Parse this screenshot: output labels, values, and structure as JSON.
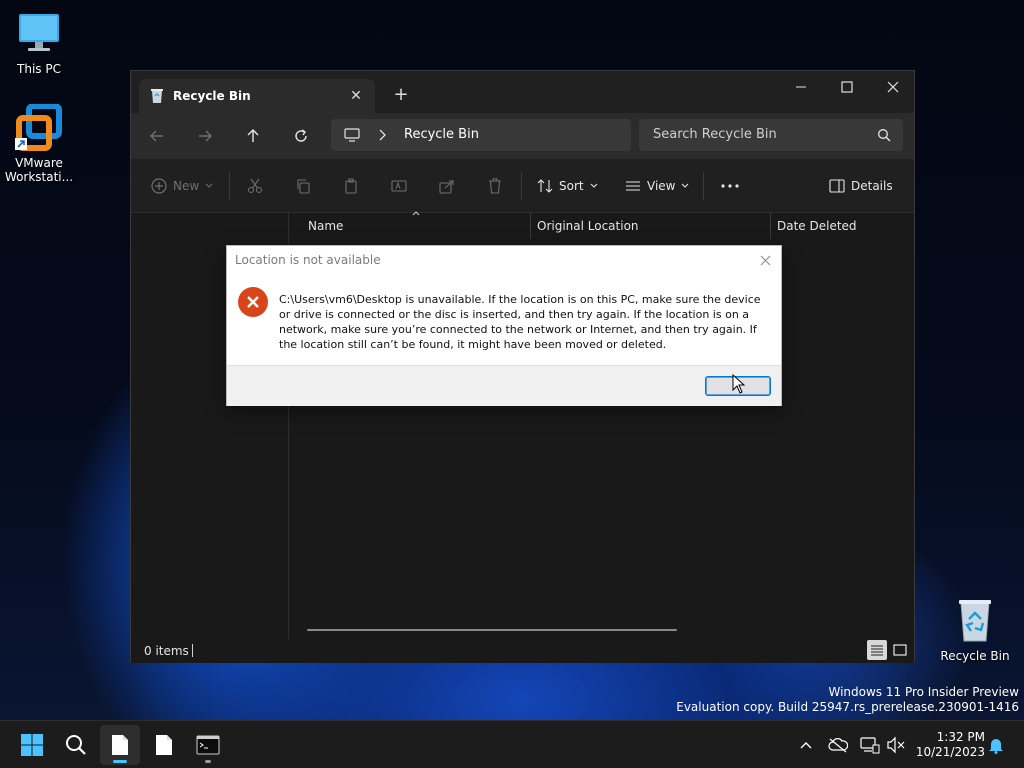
{
  "desktop": {
    "icons": [
      {
        "label": "This PC",
        "icon": "monitor-icon"
      },
      {
        "label": "VMware Workstati...",
        "icon": "vmware-icon"
      },
      {
        "label": "Recycle Bin",
        "icon": "recycle-bin-icon"
      }
    ],
    "watermark": {
      "line1": "Windows 11 Pro Insider Preview",
      "line2": "Evaluation copy. Build 25947.rs_prerelease.230901-1416"
    }
  },
  "explorer": {
    "tab_title": "Recycle Bin",
    "tab_close": "✕",
    "new_tab": "+",
    "address": {
      "location": "Recycle Bin"
    },
    "search": {
      "placeholder": "Search Recycle Bin"
    },
    "toolbar": {
      "new_label": "New",
      "sort_label": "Sort",
      "view_label": "View",
      "details_label": "Details"
    },
    "columns": [
      "Name",
      "Original Location",
      "Date Deleted"
    ],
    "status": {
      "items": "0 items"
    }
  },
  "dialog": {
    "title": "Location is not available",
    "message": "C:\\Users\\vm6\\Desktop is unavailable. If the location is on this PC, make sure the device or drive is connected or the disc is inserted, and then try again. If the location is on a network, make sure you’re connected to the network or Internet, and then try again. If the location still can’t be found, it might have been moved or deleted.",
    "ok_label": ""
  },
  "taskbar": {
    "clock": {
      "time": "1:32 PM",
      "date": "10/21/2023"
    }
  },
  "colors": {
    "accent": "#0078d4",
    "error": "#d9451b",
    "taskbar_indicator": "#4cc2ff"
  }
}
